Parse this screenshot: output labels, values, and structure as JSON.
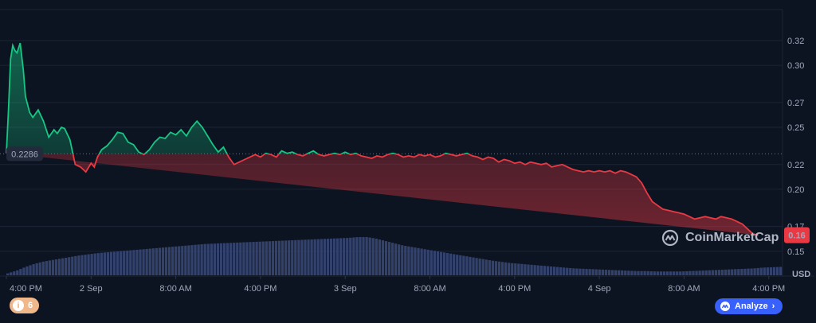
{
  "chart_data": {
    "type": "line",
    "currency_label": "USD",
    "y_ticks": [
      0.15,
      0.17,
      0.2,
      0.22,
      0.25,
      0.27,
      0.3,
      0.32
    ],
    "y_tick_labels": [
      "0.15",
      "0.17",
      "0.20",
      "0.22",
      "0.25",
      "0.27",
      "0.30",
      "0.32"
    ],
    "ylim": [
      0.13,
      0.345
    ],
    "x_ticks": [
      "4:00 PM",
      "2 Sep",
      "8:00 AM",
      "4:00 PM",
      "3 Sep",
      "8:00 AM",
      "4:00 PM",
      "4 Sep",
      "8:00 AM",
      "4:00 PM"
    ],
    "x_tick_times_hours": [
      0,
      8,
      16,
      24,
      32,
      40,
      48,
      56,
      64,
      72
    ],
    "baseline_value": 0.2286,
    "baseline_label": "0.2286",
    "current_value": 0.163,
    "current_label": "0.16",
    "colors": {
      "up": "#16c784",
      "down": "#ea3943",
      "volume": "#3a4a7a"
    },
    "series": {
      "time_hours": [
        0,
        0.2,
        0.4,
        0.6,
        0.8,
        1.0,
        1.3,
        1.6,
        1.8,
        2.2,
        2.5,
        3.0,
        3.5,
        4.0,
        4.5,
        4.8,
        5.2,
        5.5,
        6,
        6.5,
        7,
        7.5,
        8,
        8.3,
        8.6,
        9,
        9.5,
        10,
        10.5,
        11,
        11.5,
        12,
        12.5,
        13,
        13.5,
        14,
        14.5,
        15,
        15.5,
        16,
        16.5,
        17,
        17.5,
        18,
        18.5,
        19,
        19.5,
        20,
        20.5,
        21,
        21.5,
        22,
        22.5,
        23,
        23.5,
        24,
        24.5,
        25,
        25.5,
        26,
        26.5,
        27,
        27.5,
        28,
        28.5,
        29,
        29.5,
        30,
        30.5,
        31,
        31.5,
        32,
        32.5,
        33,
        33.5,
        34,
        34.5,
        35,
        35.5,
        36,
        36.5,
        37,
        37.5,
        38,
        38.5,
        39,
        39.5,
        40,
        40.5,
        41,
        41.5,
        42,
        42.5,
        43,
        43.5,
        44,
        44.5,
        45,
        45.5,
        46,
        46.5,
        47,
        47.5,
        48,
        48.5,
        49,
        49.5,
        50,
        50.5,
        51,
        51.5,
        52,
        52.5,
        53,
        53.5,
        54,
        54.5,
        55,
        55.5,
        56,
        56.5,
        57,
        57.5,
        58,
        58.5,
        59,
        59.5,
        60,
        60.5,
        61,
        61.5,
        62,
        62.5,
        63,
        63.5,
        64,
        64.5,
        65,
        65.5,
        66,
        66.5,
        67,
        67.5,
        68,
        68.5,
        69,
        69.5,
        70,
        70.5,
        71,
        71.5,
        72,
        72.5,
        73,
        73.3
      ],
      "price": [
        0.229,
        0.265,
        0.305,
        0.316,
        0.312,
        0.31,
        0.318,
        0.296,
        0.275,
        0.262,
        0.258,
        0.264,
        0.255,
        0.242,
        0.248,
        0.245,
        0.25,
        0.249,
        0.24,
        0.22,
        0.218,
        0.214,
        0.221,
        0.218,
        0.226,
        0.232,
        0.235,
        0.24,
        0.246,
        0.245,
        0.238,
        0.236,
        0.23,
        0.228,
        0.232,
        0.238,
        0.242,
        0.241,
        0.246,
        0.244,
        0.248,
        0.243,
        0.25,
        0.255,
        0.25,
        0.243,
        0.236,
        0.23,
        0.234,
        0.226,
        0.22,
        0.222,
        0.224,
        0.226,
        0.228,
        0.226,
        0.229,
        0.228,
        0.226,
        0.231,
        0.229,
        0.23,
        0.228,
        0.227,
        0.229,
        0.231,
        0.228,
        0.227,
        0.228,
        0.229,
        0.228,
        0.23,
        0.228,
        0.229,
        0.227,
        0.226,
        0.225,
        0.227,
        0.226,
        0.228,
        0.229,
        0.228,
        0.226,
        0.227,
        0.226,
        0.228,
        0.227,
        0.228,
        0.226,
        0.227,
        0.229,
        0.228,
        0.227,
        0.228,
        0.229,
        0.227,
        0.226,
        0.224,
        0.226,
        0.225,
        0.222,
        0.224,
        0.223,
        0.221,
        0.222,
        0.22,
        0.222,
        0.221,
        0.22,
        0.221,
        0.218,
        0.219,
        0.22,
        0.218,
        0.216,
        0.215,
        0.214,
        0.215,
        0.214,
        0.215,
        0.214,
        0.215,
        0.213,
        0.215,
        0.214,
        0.212,
        0.21,
        0.205,
        0.197,
        0.19,
        0.187,
        0.184,
        0.183,
        0.182,
        0.181,
        0.18,
        0.178,
        0.176,
        0.177,
        0.178,
        0.177,
        0.176,
        0.178,
        0.177,
        0.176,
        0.174,
        0.172,
        0.168,
        0.164,
        0.163
      ]
    },
    "volume_levels": [
      0.05,
      0.12,
      0.22,
      0.3,
      0.36,
      0.4,
      0.44,
      0.48,
      0.52,
      0.55,
      0.58,
      0.6,
      0.62,
      0.64,
      0.66,
      0.68,
      0.7,
      0.72,
      0.74,
      0.76,
      0.78,
      0.8,
      0.82,
      0.83,
      0.84,
      0.85,
      0.86,
      0.87,
      0.88,
      0.89,
      0.9,
      0.91,
      0.92,
      0.93,
      0.94,
      0.95,
      0.96,
      0.97,
      0.98,
      1.0,
      1.0,
      0.96,
      0.9,
      0.84,
      0.78,
      0.74,
      0.7,
      0.66,
      0.62,
      0.58,
      0.54,
      0.5,
      0.46,
      0.42,
      0.38,
      0.35,
      0.32,
      0.3,
      0.28,
      0.26,
      0.24,
      0.22,
      0.2,
      0.18,
      0.17,
      0.16,
      0.15,
      0.14,
      0.13,
      0.12,
      0.11,
      0.11,
      0.1,
      0.1,
      0.1,
      0.1,
      0.11,
      0.12,
      0.13,
      0.14,
      0.15,
      0.16,
      0.17,
      0.18,
      0.2,
      0.21,
      0.22
    ]
  },
  "watermark": {
    "text": "CoinMarketCap"
  },
  "analyze_button": {
    "label": "Analyze",
    "chevron": "›"
  },
  "notification": {
    "count": "6",
    "icon": "info-icon"
  }
}
